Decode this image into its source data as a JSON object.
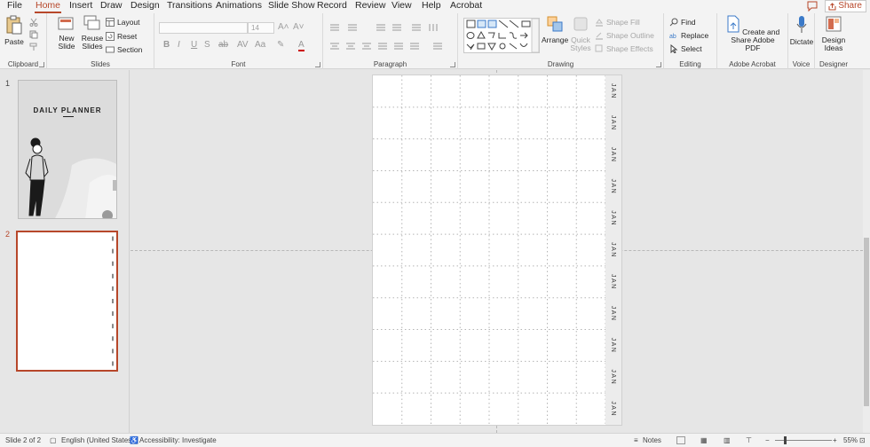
{
  "tabs": [
    "File",
    "Home",
    "Insert",
    "Draw",
    "Design",
    "Transitions",
    "Animations",
    "Slide Show",
    "Record",
    "Review",
    "View",
    "Help",
    "Acrobat"
  ],
  "active_tab": "Home",
  "share_label": "Share",
  "clipboard": {
    "paste": "Paste",
    "label": "Clipboard"
  },
  "slides_group": {
    "new_slide": "New Slide",
    "reuse_slides": "Reuse Slides",
    "layout": "Layout",
    "reset": "Reset",
    "section": "Section",
    "label": "Slides"
  },
  "font_group": {
    "font_name": "",
    "font_size": "14",
    "label": "Font",
    "bold": "B",
    "italic": "I",
    "underline": "U",
    "strike": "S"
  },
  "paragraph_group": {
    "label": "Paragraph"
  },
  "drawing_group": {
    "arrange": "Arrange",
    "quick_styles": "Quick Styles",
    "shape_fill": "Shape Fill",
    "shape_outline": "Shape Outline",
    "shape_effects": "Shape Effects",
    "label": "Drawing"
  },
  "editing_group": {
    "find": "Find",
    "replace": "Replace",
    "select": "Select",
    "label": "Editing"
  },
  "acrobat_group": {
    "create_share": "Create and Share Adobe PDF",
    "label": "Adobe Acrobat"
  },
  "voice_group": {
    "dictate": "Dictate",
    "label": "Voice"
  },
  "designer_group": {
    "design_ideas": "Design Ideas",
    "label": "Designer"
  },
  "thumbnails": [
    {
      "number": "1",
      "title": "DAILY PLANNER"
    },
    {
      "number": "2"
    }
  ],
  "slide": {
    "month_label": "JAN",
    "rows": 11,
    "cols": 8
  },
  "status": {
    "slide_info": "Slide 2 of 2",
    "language": "English (United States)",
    "accessibility": "Accessibility: Investigate",
    "notes": "Notes",
    "zoom": "55%"
  },
  "colors": {
    "accent": "#b7472a",
    "ribbon": "#f3f3f3",
    "canvas": "#e6e6e6"
  }
}
